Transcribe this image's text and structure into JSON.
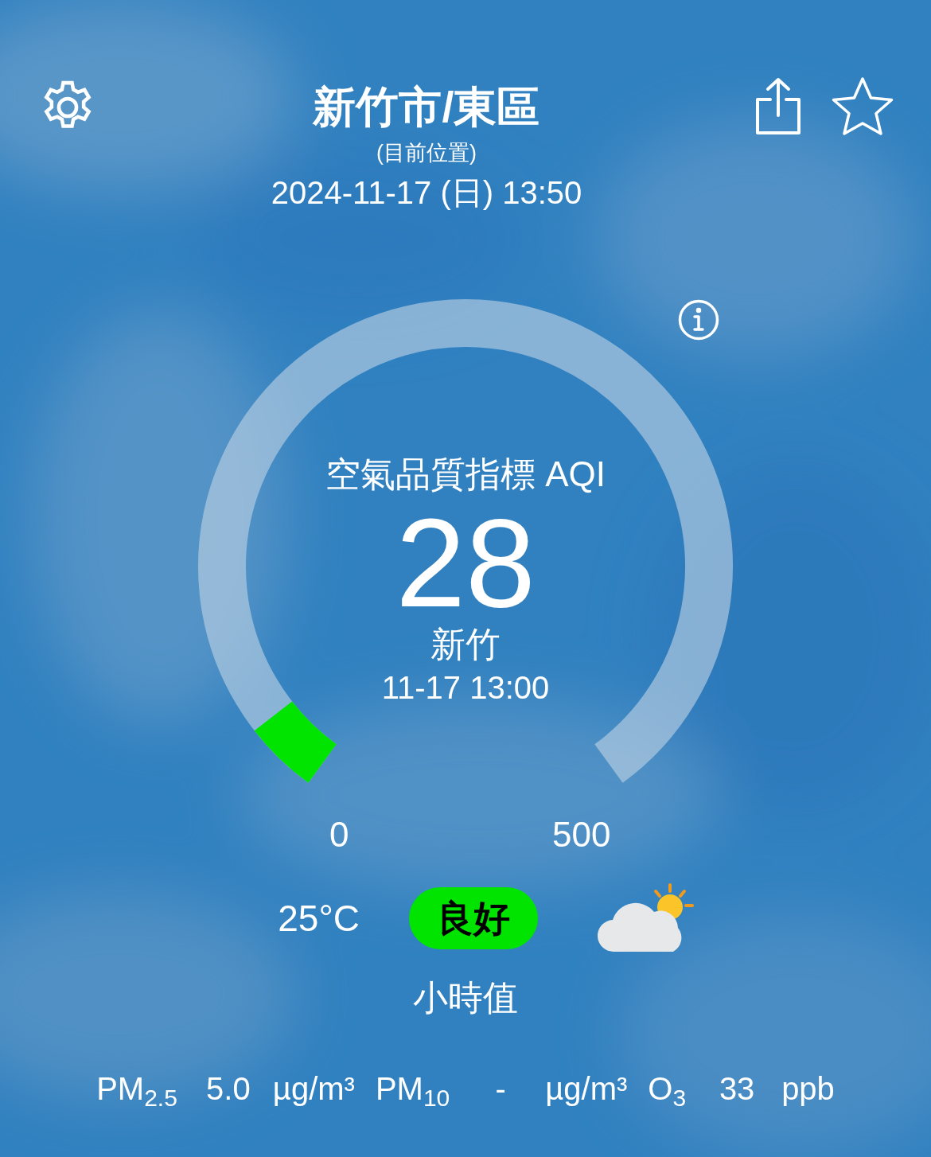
{
  "header": {
    "title": "新竹市/東區",
    "subtitle": "(目前位置)",
    "datetime": "2024-11-17 (日) 13:50"
  },
  "gauge": {
    "label": "空氣品質指標 AQI",
    "value": "28",
    "color": "#00e400",
    "station": "新竹",
    "time": "11-17 13:00",
    "min": "0",
    "max": "500"
  },
  "temperature": "25°C",
  "status": {
    "label": "良好",
    "color": "#00e400"
  },
  "interval": "小時值",
  "pollutants": [
    {
      "name": "PM$_{2.5}$",
      "value": "5.0",
      "unit": "µg/m³"
    },
    {
      "name": "PM$_{10}$",
      "value": "-",
      "unit": "µg/m³"
    },
    {
      "name": "O$_{3}$",
      "value": "33",
      "unit": "ppb"
    }
  ]
}
